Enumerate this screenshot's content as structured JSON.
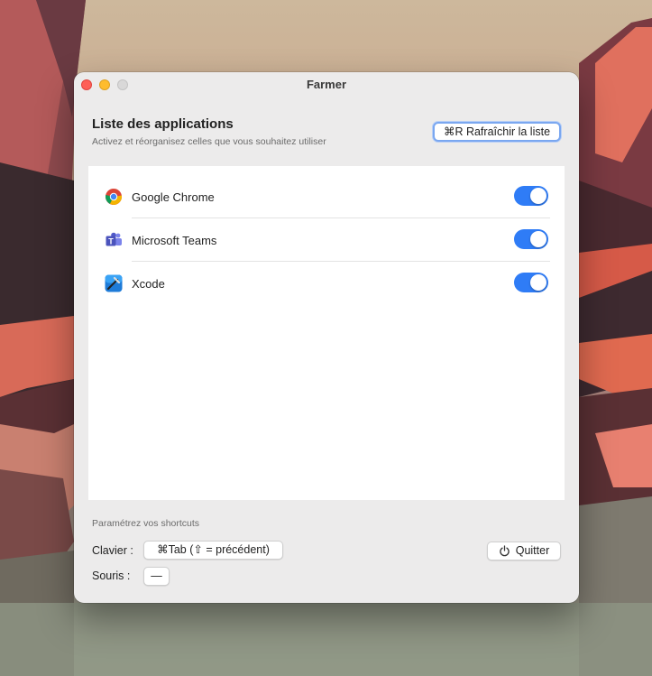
{
  "window": {
    "title": "Farmer"
  },
  "header": {
    "heading": "Liste des applications",
    "subheading": "Activez et réorganisez celles que vous souhaitez utiliser",
    "refresh_label": "⌘R Rafraîchir la liste"
  },
  "apps": [
    {
      "name": "Google Chrome",
      "icon": "chrome-icon",
      "enabled": true
    },
    {
      "name": "Microsoft Teams",
      "icon": "teams-icon",
      "enabled": true
    },
    {
      "name": "Xcode",
      "icon": "xcode-icon",
      "enabled": true
    }
  ],
  "shortcuts": {
    "title": "Paramétrez vos shortcuts",
    "keyboard_label": "Clavier :",
    "keyboard_value": "⌘Tab (⇧ = précédent)",
    "mouse_label": "Souris :",
    "mouse_value": "—",
    "quit_label": "Quitter"
  },
  "colors": {
    "accent": "#2f7cf6",
    "close": "#fe5f57",
    "minimize": "#febc2e",
    "zoom_disabled": "#d9d8d8"
  }
}
